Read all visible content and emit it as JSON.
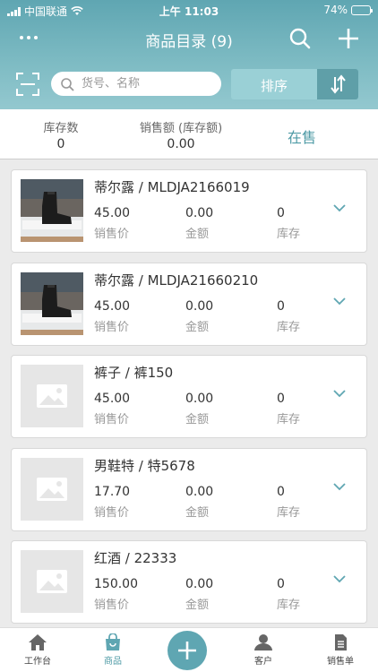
{
  "status_bar": {
    "carrier": "中国联通",
    "time": "上午 11:03",
    "battery": "74%",
    "battery_level": 0.74
  },
  "header": {
    "title": "商品目录 (9)"
  },
  "search": {
    "placeholder": "货号、名称",
    "value": ""
  },
  "sort": {
    "label": "排序"
  },
  "stats": {
    "stock_label": "库存数",
    "stock_value": "0",
    "sales_label": "销售额 (库存额)",
    "sales_value": "0.00",
    "status_tab": "在售"
  },
  "products": [
    {
      "name": "蒂尔露 / MLDJA2166019",
      "price": "45.00",
      "price_label": "销售价",
      "amount": "0.00",
      "amount_label": "金额",
      "stock": "0",
      "stock_label": "库存",
      "image": "boot-photo"
    },
    {
      "name": "蒂尔露 / MLDJA21660210",
      "price": "45.00",
      "price_label": "销售价",
      "amount": "0.00",
      "amount_label": "金额",
      "stock": "0",
      "stock_label": "库存",
      "image": "boot-photo"
    },
    {
      "name": "裤子 / 裤150",
      "price": "45.00",
      "price_label": "销售价",
      "amount": "0.00",
      "amount_label": "金额",
      "stock": "0",
      "stock_label": "库存",
      "image": "placeholder-image-icon"
    },
    {
      "name": "男鞋特 / 特5678",
      "price": "17.70",
      "price_label": "销售价",
      "amount": "0.00",
      "amount_label": "金额",
      "stock": "0",
      "stock_label": "库存",
      "image": "placeholder-image-icon"
    },
    {
      "name": "红酒 / 22333",
      "price": "150.00",
      "price_label": "销售价",
      "amount": "0.00",
      "amount_label": "金额",
      "stock": "0",
      "stock_label": "库存",
      "image": "placeholder-image-icon"
    }
  ],
  "tabbar": {
    "items": [
      {
        "label": "工作台",
        "icon": "home-icon"
      },
      {
        "label": "商品",
        "icon": "bag-icon",
        "active": true
      },
      {
        "label": "客户",
        "icon": "person-icon"
      },
      {
        "label": "销售单",
        "icon": "document-icon"
      }
    ]
  },
  "colors": {
    "accent": "#4f9ba6",
    "header": "#6fb1bb"
  }
}
